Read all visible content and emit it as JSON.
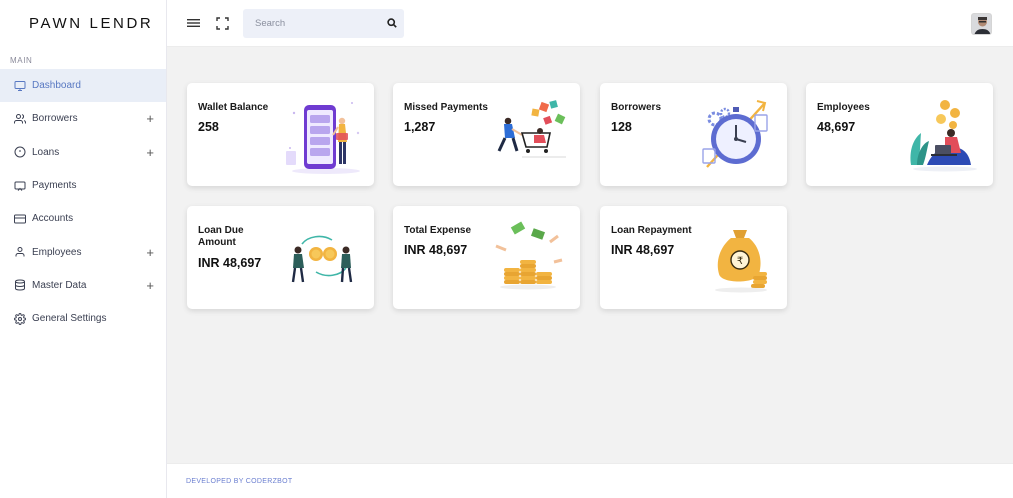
{
  "brand": "PAWN LENDR",
  "sidebar": {
    "section_label": "MAIN",
    "items": [
      {
        "label": "Dashboard",
        "icon": "monitor-icon",
        "expandable": false,
        "active": true
      },
      {
        "label": "Borrowers",
        "icon": "users-icon",
        "expandable": true,
        "active": false
      },
      {
        "label": "Loans",
        "icon": "info-icon",
        "expandable": true,
        "active": false
      },
      {
        "label": "Payments",
        "icon": "cast-icon",
        "expandable": false,
        "active": false
      },
      {
        "label": "Accounts",
        "icon": "credit-card-icon",
        "expandable": false,
        "active": false
      },
      {
        "label": "Employees",
        "icon": "user-icon",
        "expandable": true,
        "active": false
      },
      {
        "label": "Master Data",
        "icon": "database-icon",
        "expandable": true,
        "active": false
      },
      {
        "label": "General Settings",
        "icon": "gear-icon",
        "expandable": false,
        "active": false
      }
    ],
    "expand_symbol": "+"
  },
  "topbar": {
    "search_placeholder": "Search"
  },
  "cards": [
    {
      "title": "Wallet Balance",
      "value": "258",
      "illustration": "phone-wallet-illustration"
    },
    {
      "title": "Missed Payments",
      "value": "1,287",
      "illustration": "shopping-cart-illustration"
    },
    {
      "title": "Borrowers",
      "value": "128",
      "illustration": "stopwatch-illustration"
    },
    {
      "title": "Employees",
      "value": "48,697",
      "illustration": "person-laptop-illustration"
    },
    {
      "title": "Loan Due Amount",
      "value": "INR 48,697",
      "illustration": "coin-exchange-illustration"
    },
    {
      "title": "Total Expense",
      "value": "INR 48,697",
      "illustration": "coin-stack-illustration"
    },
    {
      "title": "Loan Repayment",
      "value": "INR 48,697",
      "illustration": "rupee-bag-illustration"
    }
  ],
  "footer": {
    "text": "DEVELOPED BY CODERZBOT"
  },
  "colors": {
    "accent": "#5878c2",
    "active_bg": "#e9eef7",
    "search_bg": "#edf0f8",
    "page_bg": "#f2f2f2",
    "footer_text": "#6b7fd0"
  }
}
